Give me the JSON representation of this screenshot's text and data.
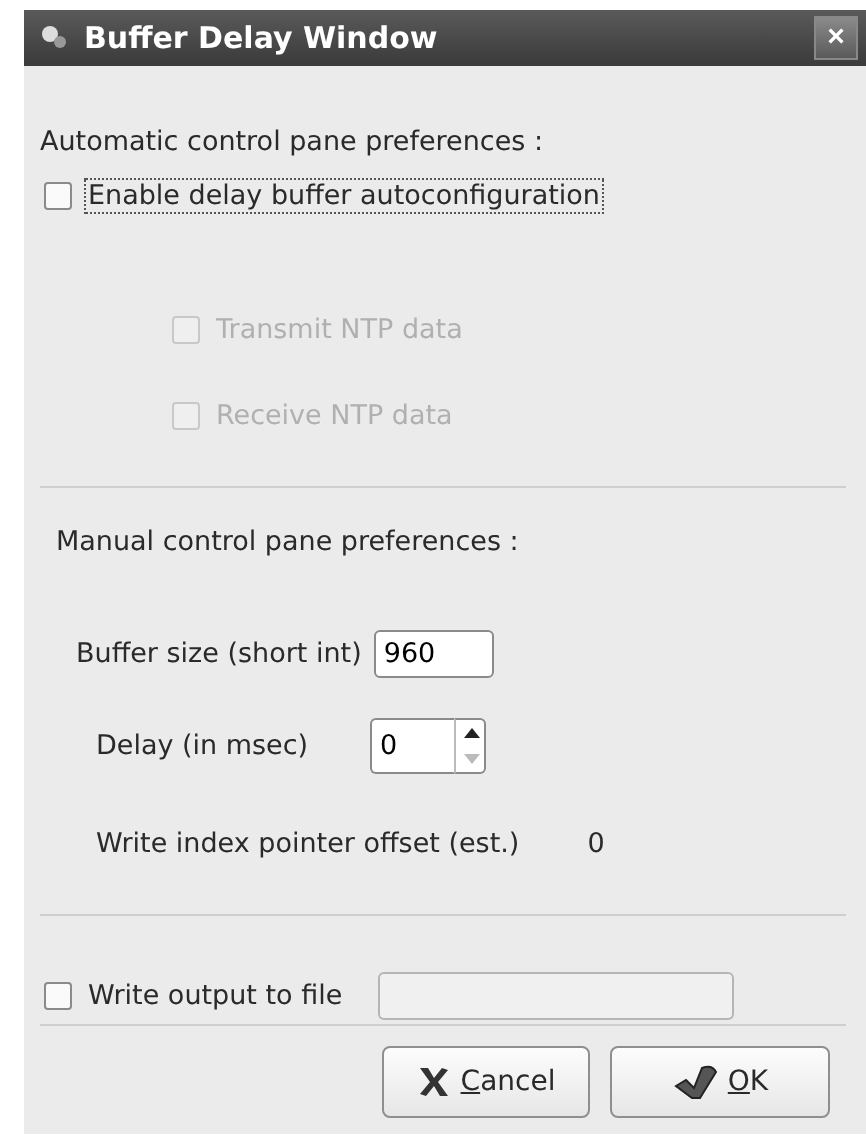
{
  "window": {
    "title": "Buffer Delay Window",
    "close_label": "×"
  },
  "automatic": {
    "heading": "Automatic control pane preferences :",
    "enable": {
      "label": "Enable delay buffer autoconfiguration",
      "checked": false,
      "focused": true
    },
    "options": [
      {
        "label": "Transmit NTP data",
        "checked": false,
        "disabled": true
      },
      {
        "label": "Receive NTP data",
        "checked": false,
        "disabled": true
      }
    ]
  },
  "manual": {
    "heading": "Manual control pane preferences :",
    "buffer_size": {
      "label": "Buffer size (short int)",
      "value": "960"
    },
    "delay": {
      "label": "Delay (in msec)",
      "value": "0"
    },
    "offset": {
      "label": "Write index pointer offset (est.)",
      "value": "0"
    }
  },
  "output": {
    "label": "Write output to file",
    "checked": false
  },
  "buttons": [
    {
      "kind": "cancel",
      "label": "Cancel"
    },
    {
      "kind": "ok",
      "label": "OK"
    }
  ]
}
